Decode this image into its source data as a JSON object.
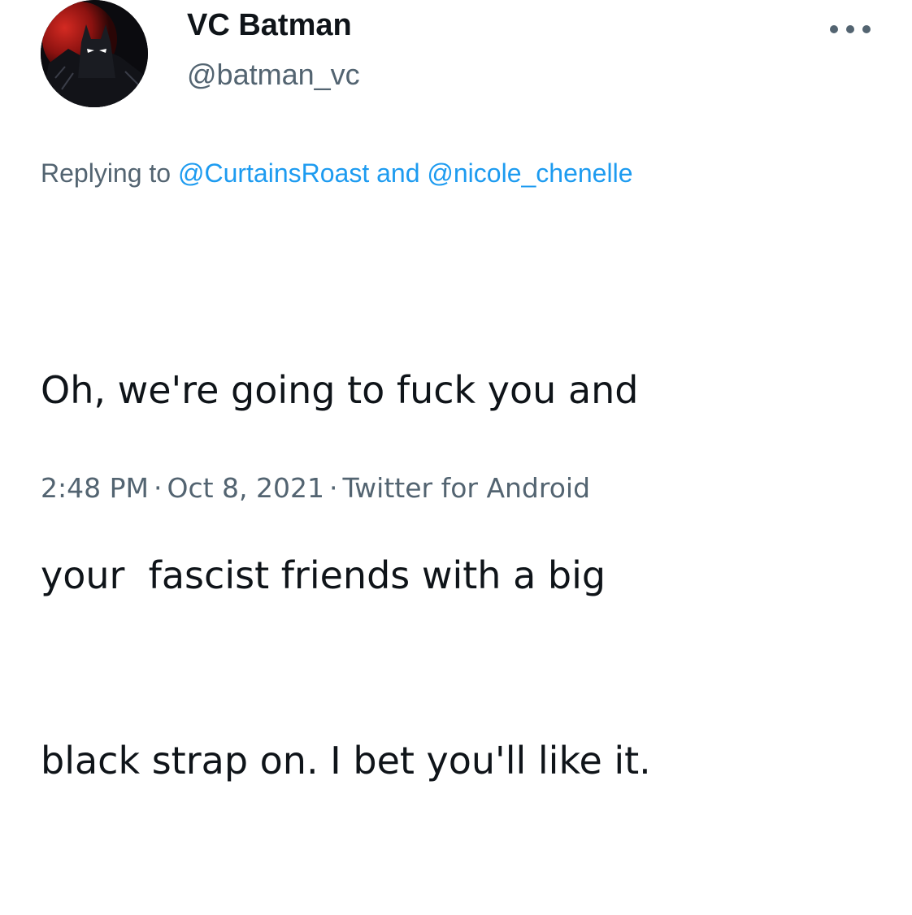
{
  "author": {
    "display_name": "VC Batman",
    "handle": "@batman_vc",
    "avatar_icon": "batman-avatar-icon"
  },
  "more_icon": "more-horizontal-icon",
  "reply": {
    "prefix": "Replying to",
    "mention_1": "@CurtainsRoast",
    "joiner": "and",
    "mention_2": "@nicole_chenelle"
  },
  "tweet": {
    "lines": [
      "Oh, we're going to fuck you and",
      "your  fascist friends with a big",
      "black strap on. I bet you'll like it."
    ]
  },
  "meta": {
    "time": "2:48 PM",
    "separator": "·",
    "date": "Oct 8, 2021",
    "source": "Twitter for Android"
  },
  "colors": {
    "text_primary": "#0f1419",
    "text_secondary": "#536471",
    "link": "#1d9bf0",
    "avatar_bg_red": "#b3161b"
  }
}
